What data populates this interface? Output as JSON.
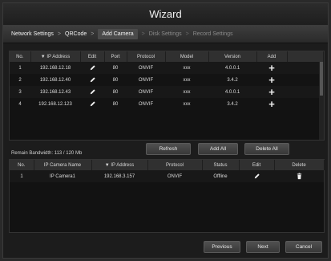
{
  "window": {
    "title": "Wizard"
  },
  "breadcrumb": [
    {
      "label": "Network Settings",
      "state": "done"
    },
    {
      "label": "QRCode",
      "state": "done"
    },
    {
      "label": "Add Camera",
      "state": "active"
    },
    {
      "label": "Disk Settings",
      "state": "pending"
    },
    {
      "label": "Record Settings",
      "state": "pending"
    }
  ],
  "breadcrumb_separator": ">",
  "search_table": {
    "headers": [
      "No.",
      "▼ IP Address",
      "Edit",
      "Port",
      "Protocol",
      "Model",
      "Version",
      "Add"
    ],
    "rows": [
      {
        "no": "1",
        "ip": "192.168.12.18",
        "port": "80",
        "protocol": "ONVIF",
        "model": "xxx",
        "version": "4.0.0.1"
      },
      {
        "no": "2",
        "ip": "192.168.12.40",
        "port": "80",
        "protocol": "ONVIF",
        "model": "xxx",
        "version": "3.4.2"
      },
      {
        "no": "3",
        "ip": "192.168.12.43",
        "port": "80",
        "protocol": "ONVIF",
        "model": "xxx",
        "version": "4.0.0.1"
      },
      {
        "no": "4",
        "ip": "192.168.12.123",
        "port": "80",
        "protocol": "ONVIF",
        "model": "xxx",
        "version": "3.4.2"
      }
    ],
    "add_icon": "plus-icon",
    "edit_icon": "pencil-icon"
  },
  "bandwidth_text": "Remain Bandwidth: 113 / 120 Mb",
  "actions": {
    "refresh": "Refresh",
    "add_all": "Add All",
    "delete_all": "Delete All"
  },
  "added_table": {
    "headers": [
      "No.",
      "IP Camera Name",
      "▼ IP Address",
      "Protocol",
      "Status",
      "Edit",
      "Delete"
    ],
    "rows": [
      {
        "no": "1",
        "name": "IP Camera1",
        "ip": "192.168.3.157",
        "protocol": "ONVIF",
        "status": "Offline"
      }
    ],
    "delete_icon": "trash-icon"
  },
  "footer": {
    "previous": "Previous",
    "next": "Next",
    "cancel": "Cancel"
  },
  "colors": {
    "background": "#1c1c1c",
    "header": "#303030",
    "button": "#454545"
  }
}
